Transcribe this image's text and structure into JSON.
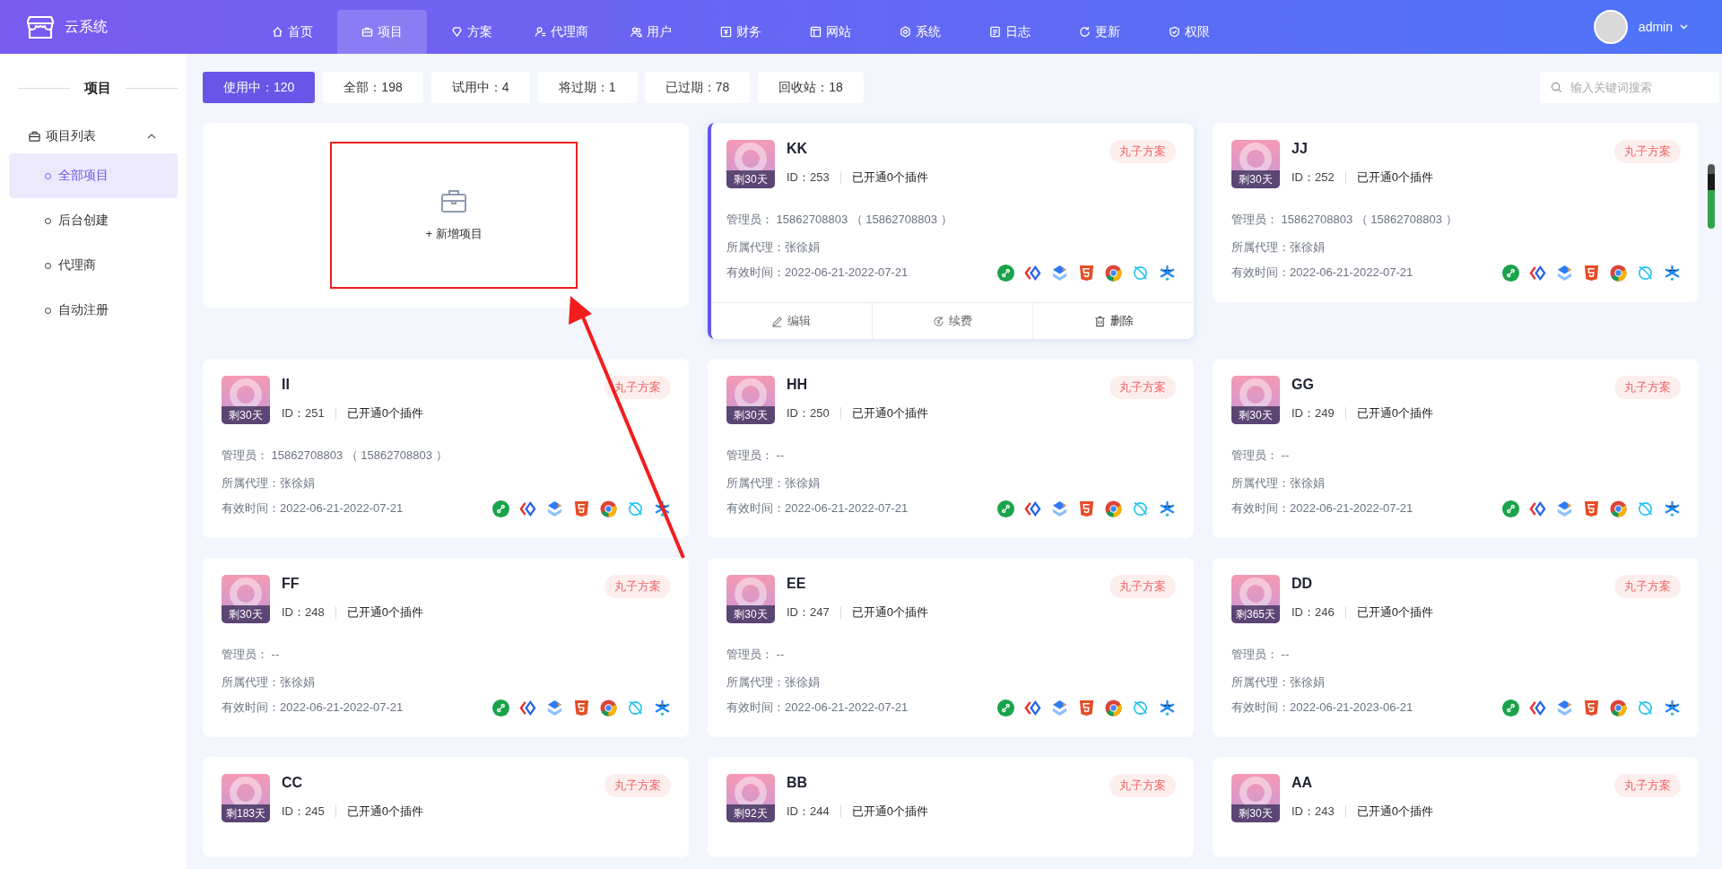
{
  "brand": {
    "name": "云系统"
  },
  "nav": [
    {
      "label": "首页",
      "selected": false
    },
    {
      "label": "项目",
      "selected": true
    },
    {
      "label": "方案",
      "selected": false
    },
    {
      "label": "代理商",
      "selected": false
    },
    {
      "label": "用户",
      "selected": false
    },
    {
      "label": "财务",
      "selected": false
    },
    {
      "label": "网站",
      "selected": false
    },
    {
      "label": "系统",
      "selected": false
    },
    {
      "label": "日志",
      "selected": false
    },
    {
      "label": "更新",
      "selected": false
    },
    {
      "label": "权限",
      "selected": false
    }
  ],
  "user": {
    "name": "admin"
  },
  "sidebar": {
    "title": "项目",
    "group": {
      "label": "项目列表",
      "expanded": true,
      "items": [
        {
          "label": "全部项目",
          "selected": true
        },
        {
          "label": "后台创建",
          "selected": false
        },
        {
          "label": "代理商",
          "selected": false
        },
        {
          "label": "自动注册",
          "selected": false
        }
      ]
    }
  },
  "filters": [
    {
      "label": "使用中：120",
      "selected": true
    },
    {
      "label": "全部：198",
      "selected": false
    },
    {
      "label": "试用中：4",
      "selected": false
    },
    {
      "label": "将过期：1",
      "selected": false
    },
    {
      "label": "已过期：78",
      "selected": false
    },
    {
      "label": "回收站：18",
      "selected": false
    }
  ],
  "search": {
    "placeholder": "输入关键词搜索"
  },
  "add_card": {
    "label": "+ 新增项目"
  },
  "projects": [
    {
      "name": "KK",
      "days": "剩30天",
      "id": "ID：253",
      "plugins": "已开通0个插件",
      "tag": "丸子方案",
      "admin": "管理员： 15862708803 （ 15862708803 ）",
      "agent": "所属代理：张徐娟",
      "valid": "有效时间：2022-06-21-2022-07-21",
      "highlighted": true,
      "actions": [
        "编辑",
        "续费",
        "删除"
      ]
    },
    {
      "name": "JJ",
      "days": "剩30天",
      "id": "ID：252",
      "plugins": "已开通0个插件",
      "tag": "丸子方案",
      "admin": "管理员： 15862708803 （ 15862708803 ）",
      "agent": "所属代理：张徐娟",
      "valid": "有效时间：2022-06-21-2022-07-21",
      "highlighted": false
    },
    {
      "name": "II",
      "days": "剩30天",
      "id": "ID：251",
      "plugins": "已开通0个插件",
      "tag": "丸子方案",
      "admin": "管理员： 15862708803 （ 15862708803 ）",
      "agent": "所属代理：张徐娟",
      "valid": "有效时间：2022-06-21-2022-07-21",
      "highlighted": false
    },
    {
      "name": "HH",
      "days": "剩30天",
      "id": "ID：250",
      "plugins": "已开通0个插件",
      "tag": "丸子方案",
      "admin": "管理员： --",
      "agent": "所属代理：张徐娟",
      "valid": "有效时间：2022-06-21-2022-07-21",
      "highlighted": false
    },
    {
      "name": "GG",
      "days": "剩30天",
      "id": "ID：249",
      "plugins": "已开通0个插件",
      "tag": "丸子方案",
      "admin": "管理员： --",
      "agent": "所属代理：张徐娟",
      "valid": "有效时间：2022-06-21-2022-07-21",
      "highlighted": false
    },
    {
      "name": "FF",
      "days": "剩30天",
      "id": "ID：248",
      "plugins": "已开通0个插件",
      "tag": "丸子方案",
      "admin": "管理员： --",
      "agent": "所属代理：张徐娟",
      "valid": "有效时间：2022-06-21-2022-07-21",
      "highlighted": false
    },
    {
      "name": "EE",
      "days": "剩30天",
      "id": "ID：247",
      "plugins": "已开通0个插件",
      "tag": "丸子方案",
      "admin": "管理员： --",
      "agent": "所属代理：张徐娟",
      "valid": "有效时间：2022-06-21-2022-07-21",
      "highlighted": false
    },
    {
      "name": "DD",
      "days": "剩365天",
      "id": "ID：246",
      "plugins": "已开通0个插件",
      "tag": "丸子方案",
      "admin": "管理员： --",
      "agent": "所属代理：张徐娟",
      "valid": "有效时间：2022-06-21-2023-06-21",
      "highlighted": false
    },
    {
      "name": "CC",
      "days": "剩183天",
      "id": "ID：245",
      "plugins": "已开通0个插件",
      "tag": "丸子方案",
      "highlighted": false
    },
    {
      "name": "BB",
      "days": "剩92天",
      "id": "ID：244",
      "plugins": "已开通0个插件",
      "tag": "丸子方案",
      "highlighted": false
    },
    {
      "name": "AA",
      "days": "剩30天",
      "id": "ID：243",
      "plugins": "已开通0个插件",
      "tag": "丸子方案",
      "highlighted": false
    }
  ]
}
